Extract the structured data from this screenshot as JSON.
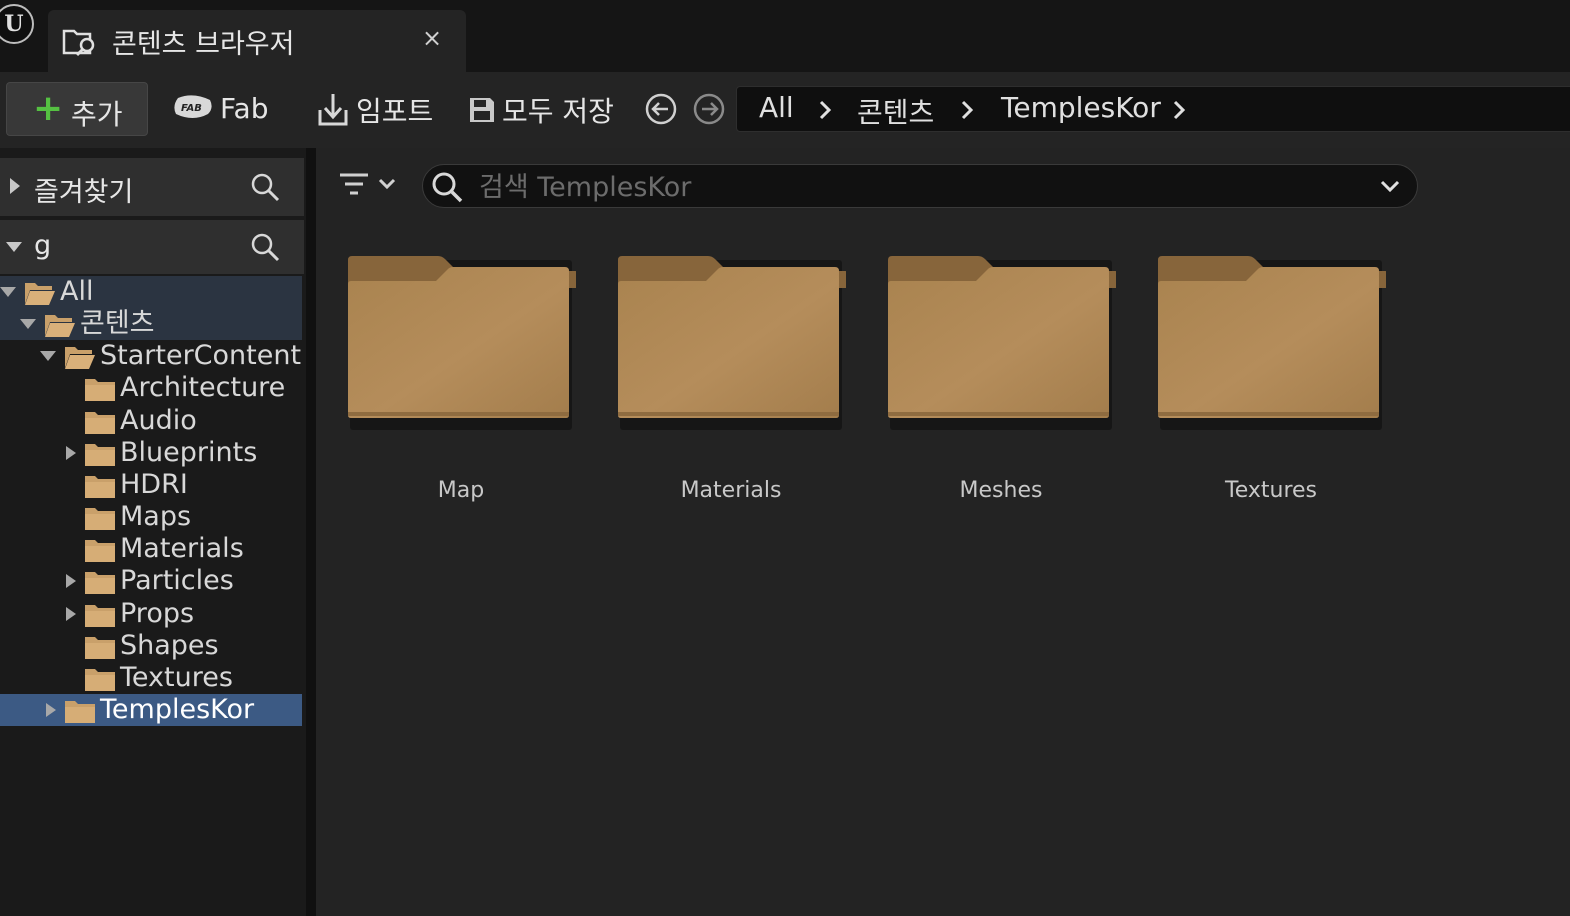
{
  "window": {
    "logo_letter": "U",
    "tab_title": "콘텐츠 브라우저",
    "tab_close": "×"
  },
  "toolbar": {
    "add_label": "추가",
    "fab_label": "Fab",
    "import_label": "임포트",
    "save_all_label": "모두 저장",
    "breadcrumb": [
      "All",
      "콘텐츠",
      "TemplesKor"
    ]
  },
  "sidebar": {
    "favorites_label": "즐겨찾기",
    "project_label": "g",
    "tree": [
      {
        "label": "All",
        "depth": 0,
        "expander": "expanded",
        "open": true,
        "state": "highlight"
      },
      {
        "label": "콘텐츠",
        "depth": 1,
        "expander": "expanded",
        "open": true,
        "state": "highlight"
      },
      {
        "label": "StarterContent",
        "depth": 2,
        "expander": "expanded",
        "open": true,
        "state": ""
      },
      {
        "label": "Architecture",
        "depth": 3,
        "expander": "none",
        "open": false,
        "state": ""
      },
      {
        "label": "Audio",
        "depth": 3,
        "expander": "none",
        "open": false,
        "state": ""
      },
      {
        "label": "Blueprints",
        "depth": 3,
        "expander": "collapsed",
        "open": false,
        "state": ""
      },
      {
        "label": "HDRI",
        "depth": 3,
        "expander": "none",
        "open": false,
        "state": ""
      },
      {
        "label": "Maps",
        "depth": 3,
        "expander": "none",
        "open": false,
        "state": ""
      },
      {
        "label": "Materials",
        "depth": 3,
        "expander": "none",
        "open": false,
        "state": ""
      },
      {
        "label": "Particles",
        "depth": 3,
        "expander": "collapsed",
        "open": false,
        "state": ""
      },
      {
        "label": "Props",
        "depth": 3,
        "expander": "collapsed",
        "open": false,
        "state": ""
      },
      {
        "label": "Shapes",
        "depth": 3,
        "expander": "none",
        "open": false,
        "state": ""
      },
      {
        "label": "Textures",
        "depth": 3,
        "expander": "none",
        "open": false,
        "state": ""
      },
      {
        "label": "TemplesKor",
        "depth": 2,
        "expander": "collapsed",
        "open": false,
        "state": "selected"
      }
    ]
  },
  "content": {
    "search_placeholder": "검색 TemplesKor",
    "search_value": "",
    "items": [
      {
        "label": "Map"
      },
      {
        "label": "Materials"
      },
      {
        "label": "Meshes"
      },
      {
        "label": "Textures"
      }
    ]
  },
  "colors": {
    "accent_add": "#55c142",
    "selection": "#3c5a84",
    "highlight": "#2b3441",
    "folder": "#b58d5b"
  }
}
